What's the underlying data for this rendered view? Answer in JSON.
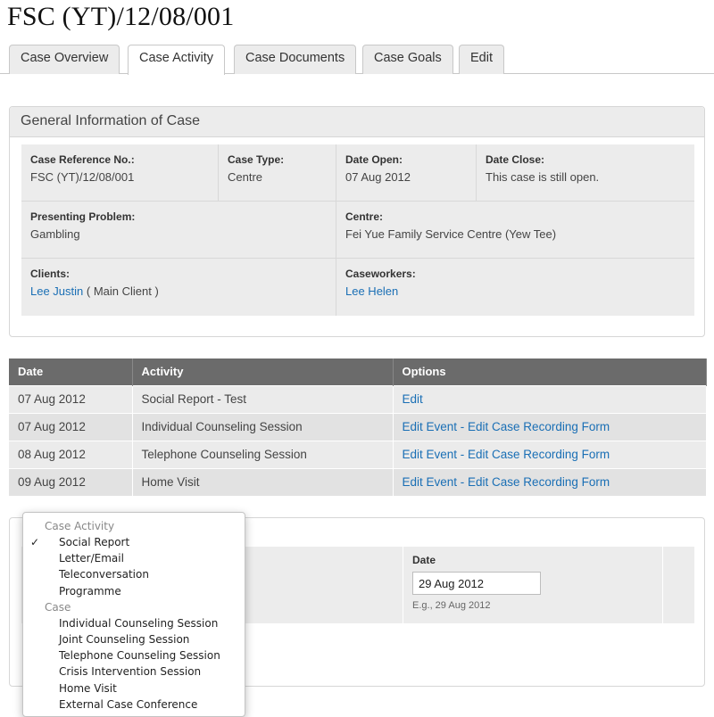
{
  "page": {
    "title": "FSC (YT)/12/08/001"
  },
  "tabs": [
    {
      "label": "Case Overview"
    },
    {
      "label": "Case Activity"
    },
    {
      "label": "Case Documents"
    },
    {
      "label": "Case Goals"
    },
    {
      "label": "Edit"
    }
  ],
  "general": {
    "heading": "General Information of Case",
    "case_ref": {
      "label": "Case Reference No.:",
      "value": "FSC (YT)/12/08/001"
    },
    "case_type": {
      "label": "Case Type:",
      "value": "Centre"
    },
    "date_open": {
      "label": "Date Open:",
      "value": "07 Aug 2012"
    },
    "date_close": {
      "label": "Date Close:",
      "value": "This case is still open."
    },
    "problem": {
      "label": "Presenting Problem:",
      "value": "Gambling"
    },
    "centre": {
      "label": "Centre:",
      "value": "Fei Yue Family Service Centre (Yew Tee)"
    },
    "clients": {
      "label": "Clients:",
      "link": "Lee Justin",
      "suffix": " ( Main Client )"
    },
    "caseworkers": {
      "label": "Caseworkers:",
      "link": "Lee Helen"
    }
  },
  "activity_table": {
    "headers": [
      "Date",
      "Activity",
      "Options"
    ],
    "rows": [
      {
        "date": "07 Aug 2012",
        "activity": "Social Report - Test",
        "options": "Edit"
      },
      {
        "date": "07 Aug 2012",
        "activity": "Individual Counseling Session",
        "options": "Edit Event - Edit Case Recording Form"
      },
      {
        "date": "08 Aug 2012",
        "activity": "Telephone Counseling Session",
        "options": "Edit Event - Edit Case Recording Form"
      },
      {
        "date": "09 Aug 2012",
        "activity": "Home Visit",
        "options": "Edit Event - Edit Case Recording Form"
      }
    ]
  },
  "new_activity": {
    "date_label": "Date",
    "date_value": "29 Aug 2012",
    "date_hint": "E.g., 29 Aug 2012"
  },
  "dropdown": {
    "check": "✓",
    "groups": [
      {
        "label": "Case Activity",
        "items": [
          "Social Report",
          "Letter/Email",
          "Teleconversation",
          "Programme"
        ]
      },
      {
        "label": "Case",
        "items": [
          "Individual Counseling Session",
          "Joint Counseling Session",
          "Telephone Counseling Session",
          "Crisis Intervention Session",
          "Home Visit",
          "External Case Conference"
        ]
      }
    ],
    "selected": "Social Report"
  }
}
